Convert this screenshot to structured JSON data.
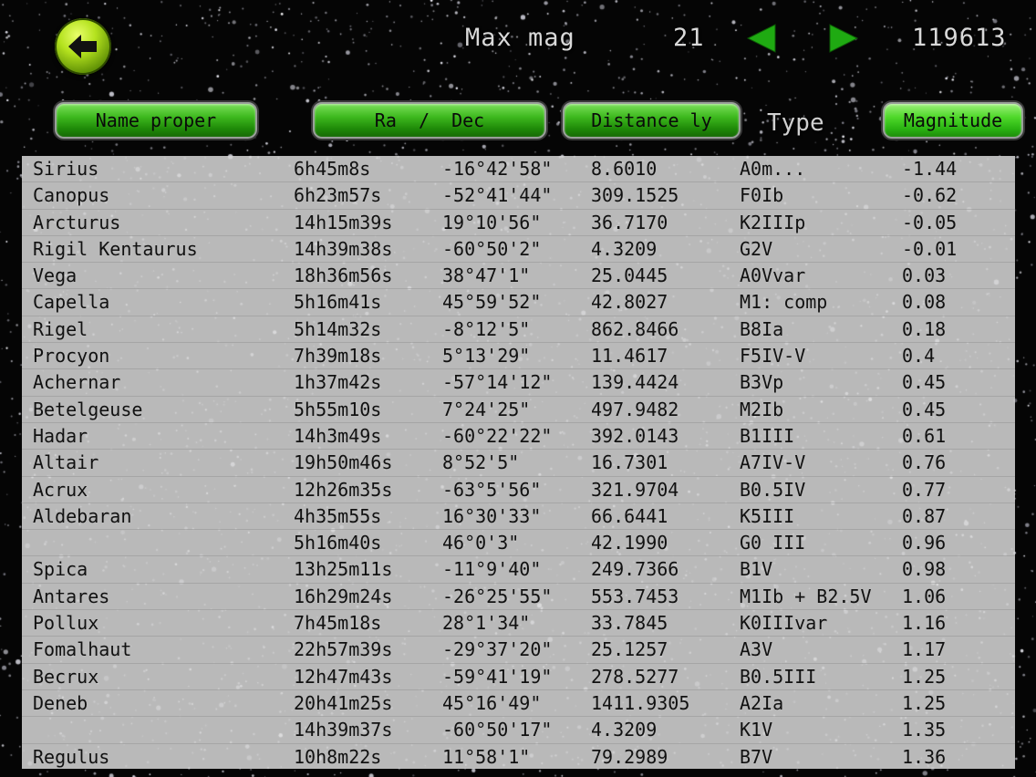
{
  "header": {
    "max_mag_label": "Max mag",
    "max_mag_value": "21",
    "star_count": "119613",
    "prev_icon": "left-triangle-icon",
    "next_icon": "right-triangle-icon",
    "back_icon": "back-arrow-icon"
  },
  "columns": {
    "name": "Name proper",
    "radec": "Ra  /  Dec",
    "distance": "Distance ly",
    "type": "Type",
    "magnitude": "Magnitude"
  },
  "colors": {
    "button_green": "#2ab412",
    "back_button": "#9ed21a",
    "arrow_green": "#1faa12"
  },
  "rows": [
    [
      "Sirius",
      "6h45m8s",
      "-16°42'58\"",
      "8.6010",
      "A0m...",
      "-1.44"
    ],
    [
      "Canopus",
      "6h23m57s",
      "-52°41'44\"",
      "309.1525",
      "F0Ib",
      "-0.62"
    ],
    [
      "Arcturus",
      "14h15m39s",
      "19°10'56\"",
      "36.7170",
      "K2IIIp",
      "-0.05"
    ],
    [
      "Rigil Kentaurus",
      "14h39m38s",
      "-60°50'2\"",
      "4.3209",
      "G2V",
      "-0.01"
    ],
    [
      "Vega",
      "18h36m56s",
      "38°47'1\"",
      "25.0445",
      "A0Vvar",
      "0.03"
    ],
    [
      "Capella",
      "5h16m41s",
      "45°59'52\"",
      "42.8027",
      "M1: comp",
      "0.08"
    ],
    [
      "Rigel",
      "5h14m32s",
      "-8°12'5\"",
      "862.8466",
      "B8Ia",
      "0.18"
    ],
    [
      "Procyon",
      "7h39m18s",
      "5°13'29\"",
      "11.4617",
      "F5IV-V",
      "0.4"
    ],
    [
      "Achernar",
      "1h37m42s",
      "-57°14'12\"",
      "139.4424",
      "B3Vp",
      "0.45"
    ],
    [
      "Betelgeuse",
      "5h55m10s",
      "7°24'25\"",
      "497.9482",
      "M2Ib",
      "0.45"
    ],
    [
      "Hadar",
      "14h3m49s",
      "-60°22'22\"",
      "392.0143",
      "B1III",
      "0.61"
    ],
    [
      "Altair",
      "19h50m46s",
      "8°52'5\"",
      "16.7301",
      "A7IV-V",
      "0.76"
    ],
    [
      "Acrux",
      "12h26m35s",
      "-63°5'56\"",
      "321.9704",
      "B0.5IV",
      "0.77"
    ],
    [
      "Aldebaran",
      "4h35m55s",
      "16°30'33\"",
      "66.6441",
      "K5III",
      "0.87"
    ],
    [
      "",
      "5h16m40s",
      "46°0'3\"",
      "42.1990",
      "G0 III",
      "0.96"
    ],
    [
      "Spica",
      "13h25m11s",
      "-11°9'40\"",
      "249.7366",
      "B1V",
      "0.98"
    ],
    [
      "Antares",
      "16h29m24s",
      "-26°25'55\"",
      "553.7453",
      "M1Ib + B2.5V",
      "1.06"
    ],
    [
      "Pollux",
      "7h45m18s",
      "28°1'34\"",
      "33.7845",
      "K0IIIvar",
      "1.16"
    ],
    [
      "Fomalhaut",
      "22h57m39s",
      "-29°37'20\"",
      "25.1257",
      "A3V",
      "1.17"
    ],
    [
      "Becrux",
      "12h47m43s",
      "-59°41'19\"",
      "278.5277",
      "B0.5III",
      "1.25"
    ],
    [
      "Deneb",
      "20h41m25s",
      "45°16'49\"",
      "1411.9305",
      "A2Ia",
      "1.25"
    ],
    [
      "",
      "14h39m37s",
      "-60°50'17\"",
      "4.3209",
      "K1V",
      "1.35"
    ],
    [
      "Regulus",
      "10h8m22s",
      "11°58'1\"",
      "79.2989",
      "B7V",
      "1.36"
    ]
  ]
}
